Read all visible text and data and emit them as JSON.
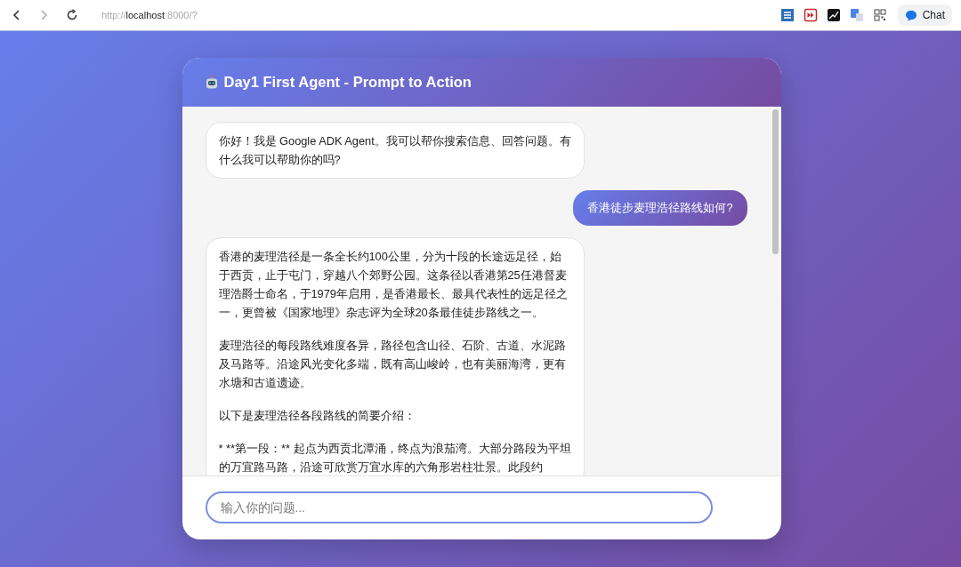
{
  "browser": {
    "url_scheme": "http://",
    "url_host": "localhost",
    "url_rest": ":8000/?",
    "chat_button": "Chat"
  },
  "chat": {
    "title": "Day1 First Agent - Prompt to Action",
    "messages": [
      {
        "kind": "agent",
        "paragraphs": [
          "你好！我是 Google ADK Agent。我可以帮你搜索信息、回答问题。有什么我可以帮助你的吗?"
        ]
      },
      {
        "kind": "user",
        "paragraphs": [
          "香港徒步麦理浩径路线如何?"
        ]
      },
      {
        "kind": "agent",
        "paragraphs": [
          "香港的麦理浩径是一条全长约100公里，分为十段的长途远足径，始于西贡，止于屯门，穿越八个郊野公园。这条径以香港第25任港督麦理浩爵士命名，于1979年启用，是香港最长、最具代表性的远足径之一，更曾被《国家地理》杂志评为全球20条最佳徒步路线之一。",
          "麦理浩径的每段路线难度各异，路径包含山径、石阶、古道、水泥路及马路等。沿途风光变化多端，既有高山峻岭，也有美丽海湾，更有水塘和古道遗迹。",
          "以下是麦理浩径各段路线的简要介绍：",
          "* **第一段：** 起点为西贡北潭涌，终点为浪茄湾。大部分路段为平坦的万宜路马路，沿途可欣赏万宜水库的六角形岩柱壮景。此段约"
        ]
      }
    ],
    "input": {
      "placeholder": "输入你的问题..."
    }
  }
}
